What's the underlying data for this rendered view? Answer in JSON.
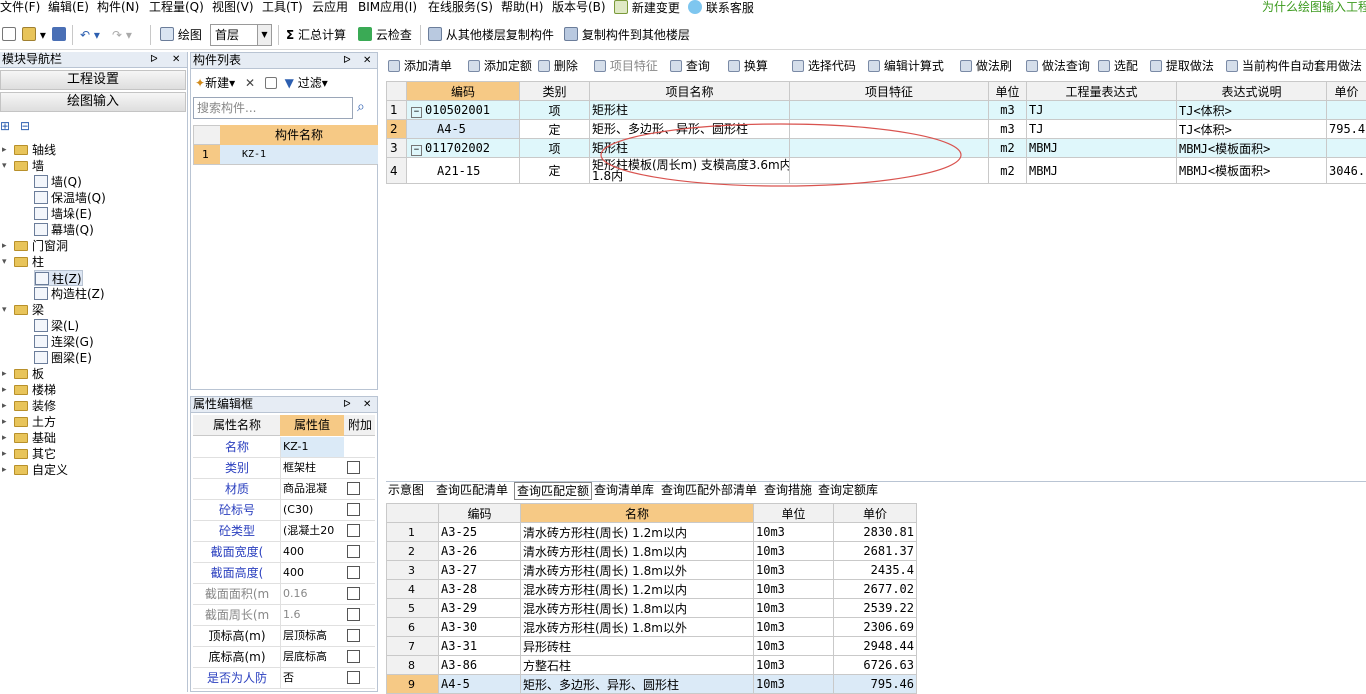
{
  "menu": [
    "文件(F)",
    "编辑(E)",
    "构件(N)",
    "工程量(Q)",
    "视图(V)",
    "工具(T)",
    "云应用",
    "BIM应用(I)",
    "在线服务(S)",
    "帮助(H)",
    "版本号(B)",
    "新建变更",
    "联系客服"
  ],
  "tip": "为什么绘图输入工程",
  "toolbar": {
    "draw": "绘图",
    "floor": "首层",
    "sum_calc": "汇总计算",
    "cloud_check": "云检查",
    "copy_from": "从其他楼层复制构件",
    "copy_to": "复制构件到其他楼层"
  },
  "nav": {
    "title": "模块导航栏",
    "project_settings": "工程设置",
    "drawing_input": "绘图输入",
    "tree": [
      {
        "label": "轴线",
        "level": 0,
        "type": "folder",
        "toggle": "+"
      },
      {
        "label": "墙",
        "level": 0,
        "type": "folder",
        "toggle": "-"
      },
      {
        "label": "墙(Q)",
        "level": 1,
        "type": "leaf"
      },
      {
        "label": "保温墙(Q)",
        "level": 1,
        "type": "leaf"
      },
      {
        "label": "墙垛(E)",
        "level": 1,
        "type": "leaf"
      },
      {
        "label": "幕墙(Q)",
        "level": 1,
        "type": "leaf"
      },
      {
        "label": "门窗洞",
        "level": 0,
        "type": "folder",
        "toggle": "+"
      },
      {
        "label": "柱",
        "level": 0,
        "type": "folder",
        "toggle": "-"
      },
      {
        "label": "柱(Z)",
        "level": 1,
        "type": "leaf",
        "selected": true
      },
      {
        "label": "构造柱(Z)",
        "level": 1,
        "type": "leaf"
      },
      {
        "label": "梁",
        "level": 0,
        "type": "folder",
        "toggle": "-"
      },
      {
        "label": "梁(L)",
        "level": 1,
        "type": "leaf"
      },
      {
        "label": "连梁(G)",
        "level": 1,
        "type": "leaf"
      },
      {
        "label": "圈梁(E)",
        "level": 1,
        "type": "leaf"
      },
      {
        "label": "板",
        "level": 0,
        "type": "folder",
        "toggle": "+"
      },
      {
        "label": "楼梯",
        "level": 0,
        "type": "folder",
        "toggle": "+"
      },
      {
        "label": "装修",
        "level": 0,
        "type": "folder",
        "toggle": "+"
      },
      {
        "label": "土方",
        "level": 0,
        "type": "folder",
        "toggle": "+"
      },
      {
        "label": "基础",
        "level": 0,
        "type": "folder",
        "toggle": "+"
      },
      {
        "label": "其它",
        "level": 0,
        "type": "folder",
        "toggle": "+"
      },
      {
        "label": "自定义",
        "level": 0,
        "type": "folder",
        "toggle": "+"
      }
    ]
  },
  "complist": {
    "title": "构件列表",
    "new": "新建",
    "filter": "过滤",
    "search_placeholder": "搜索构件...",
    "col_name": "构件名称",
    "rows": [
      {
        "no": "1",
        "name": "KZ-1"
      }
    ]
  },
  "props": {
    "title": "属性编辑框",
    "col_name": "属性名称",
    "col_value": "属性值",
    "col_extra": "附加",
    "rows": [
      {
        "name": "名称",
        "value": "KZ-1",
        "style": "blue",
        "check": false
      },
      {
        "name": "类别",
        "value": "框架柱",
        "style": "blue",
        "check": true
      },
      {
        "name": "材质",
        "value": "商品混凝",
        "style": "blue",
        "check": true
      },
      {
        "name": "砼标号",
        "value": "(C30)",
        "style": "blue",
        "check": true
      },
      {
        "name": "砼类型",
        "value": "(混凝土20",
        "style": "blue",
        "check": true
      },
      {
        "name": "截面宽度(",
        "value": "400",
        "style": "blue",
        "check": true
      },
      {
        "name": "截面高度(",
        "value": "400",
        "style": "blue",
        "check": true
      },
      {
        "name": "截面面积(m",
        "value": "0.16",
        "style": "gray",
        "check": true
      },
      {
        "name": "截面周长(m",
        "value": "1.6",
        "style": "gray",
        "check": true
      },
      {
        "name": "顶标高(m)",
        "value": "层顶标高",
        "style": "black",
        "check": true
      },
      {
        "name": "底标高(m)",
        "value": "层底标高",
        "style": "black",
        "check": true
      },
      {
        "name": "是否为人防",
        "value": "否",
        "style": "blue",
        "check": true
      }
    ]
  },
  "toolbar2": [
    "添加清单",
    "添加定额",
    "删除",
    "项目特征",
    "查询",
    "换算",
    "选择代码",
    "编辑计算式",
    "做法刷",
    "做法查询",
    "选配",
    "提取做法",
    "当前构件自动套用做法"
  ],
  "top_grid": {
    "headers": [
      "编码",
      "类别",
      "项目名称",
      "项目特征",
      "单位",
      "工程量表达式",
      "表达式说明",
      "单价"
    ],
    "rows": [
      {
        "no": "1",
        "code": "010502001",
        "type": "项",
        "name": "矩形柱",
        "feature": "",
        "unit": "m3",
        "expr": "TJ",
        "desc": "TJ<体积>",
        "price": "",
        "cyan": true,
        "box": "−"
      },
      {
        "no": "2",
        "code": "A4-5",
        "type": "定",
        "name": "矩形、多边形、异形、圆形柱",
        "feature": "",
        "unit": "m3",
        "expr": "TJ",
        "desc": "TJ<体积>",
        "price": "795.4",
        "cyan": false
      },
      {
        "no": "3",
        "code": "011702002",
        "type": "项",
        "name": "矩形柱",
        "feature": "",
        "unit": "m2",
        "expr": "MBMJ",
        "desc": "MBMJ<模板面积>",
        "price": "",
        "cyan": true,
        "box": "−"
      },
      {
        "no": "4",
        "code": "A21-15",
        "type": "定",
        "name": "矩形柱模板(周长m) 支模高度3.6m内",
        "name2": "1.8内",
        "feature": "",
        "unit": "m2",
        "expr": "MBMJ",
        "desc": "MBMJ<模板面积>",
        "price": "3046.",
        "cyan": false
      }
    ]
  },
  "tabs": [
    "示意图",
    "查询匹配清单",
    "查询匹配定额",
    "查询清单库",
    "查询匹配外部清单",
    "查询措施",
    "查询定额库"
  ],
  "active_tab": "查询匹配定额",
  "bottom_grid": {
    "headers": [
      "编码",
      "名称",
      "单位",
      "单价"
    ],
    "rows": [
      {
        "no": "1",
        "code": "A3-25",
        "name": "清水砖方形柱(周长) 1.2m以内",
        "unit": "10m3",
        "price": "2830.81"
      },
      {
        "no": "2",
        "code": "A3-26",
        "name": "清水砖方形柱(周长) 1.8m以内",
        "unit": "10m3",
        "price": "2681.37"
      },
      {
        "no": "3",
        "code": "A3-27",
        "name": "清水砖方形柱(周长) 1.8m以外",
        "unit": "10m3",
        "price": "2435.4"
      },
      {
        "no": "4",
        "code": "A3-28",
        "name": "混水砖方形柱(周长) 1.2m以内",
        "unit": "10m3",
        "price": "2677.02"
      },
      {
        "no": "5",
        "code": "A3-29",
        "name": "混水砖方形柱(周长) 1.8m以内",
        "unit": "10m3",
        "price": "2539.22"
      },
      {
        "no": "6",
        "code": "A3-30",
        "name": "混水砖方形柱(周长) 1.8m以外",
        "unit": "10m3",
        "price": "2306.69"
      },
      {
        "no": "7",
        "code": "A3-31",
        "name": "异形砖柱",
        "unit": "10m3",
        "price": "2948.44"
      },
      {
        "no": "8",
        "code": "A3-86",
        "name": "方整石柱",
        "unit": "10m3",
        "price": "6726.63"
      },
      {
        "no": "9",
        "code": "A4-5",
        "name": "矩形、多边形、异形、圆形柱",
        "unit": "10m3",
        "price": "795.46",
        "selected": true
      }
    ]
  },
  "colors": {
    "accent_orange": "#f6c985",
    "cyan_row": "#dff7fb",
    "annotation": "#d9534f",
    "link_blue": "#2a3fbf"
  }
}
